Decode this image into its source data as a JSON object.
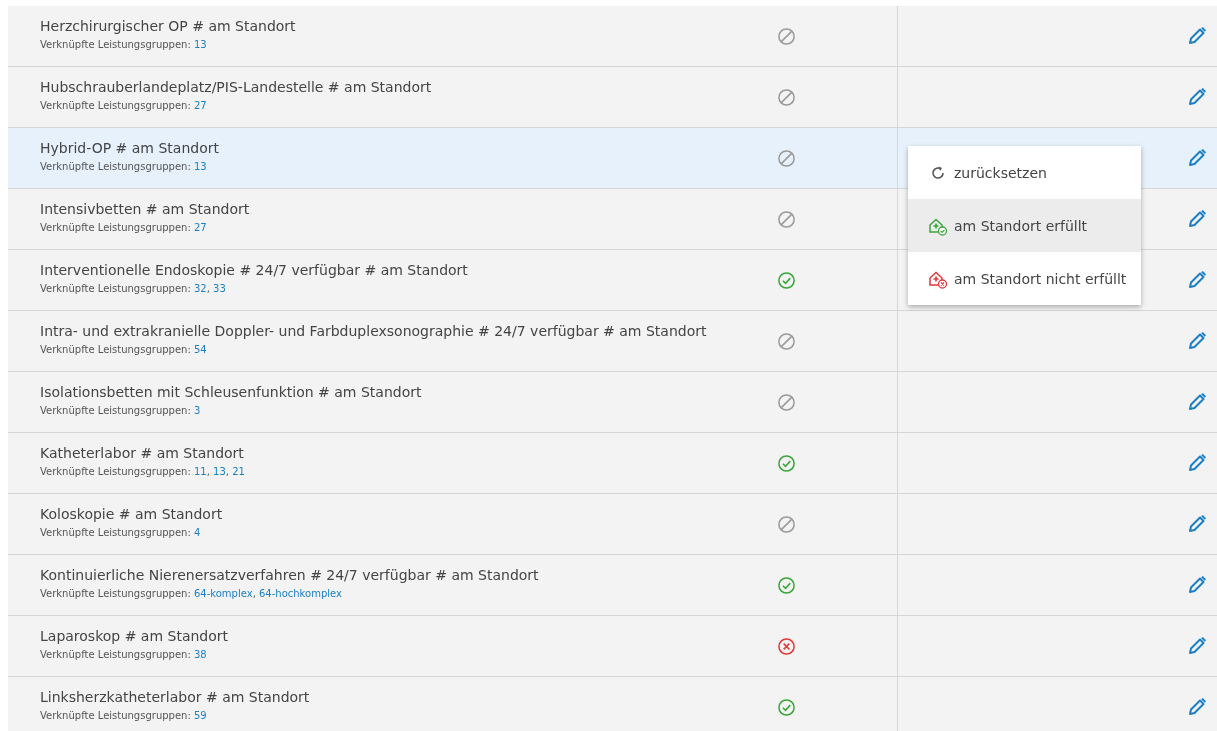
{
  "rows": [
    {
      "title": "Herzchirurgischer OP # am Standort",
      "groups_label": "Verknüpfte Leistungsgruppen:",
      "groups": [
        "13"
      ],
      "kind": "none",
      "selected": false
    },
    {
      "title": "Hubschrauberlandeplatz/PIS-Landestelle # am Standort",
      "groups_label": "Verknüpfte Leistungsgruppen:",
      "groups": [
        "27"
      ],
      "kind": "none",
      "selected": false
    },
    {
      "title": "Hybrid-OP # am Standort",
      "groups_label": "Verknüpfte Leistungsgruppen:",
      "groups": [
        "13"
      ],
      "kind": "none",
      "selected": true
    },
    {
      "title": "Intensivbetten # am Standort",
      "groups_label": "Verknüpfte Leistungsgruppen:",
      "groups": [
        "27"
      ],
      "kind": "none",
      "selected": false
    },
    {
      "title": "Interventionelle Endoskopie # 24/7 verfügbar # am Standort",
      "groups_label": "Verknüpfte Leistungsgruppen:",
      "groups": [
        "32",
        "33"
      ],
      "group_separator": ",",
      "kind": "fulfilled",
      "selected": false
    },
    {
      "title": "Intra- und extrakranielle Doppler- und Farbduplexsonographie # 24/7 verfügbar # am Standort",
      "groups_label": "Verknüpfte Leistungsgruppen:",
      "groups": [
        "54"
      ],
      "kind": "none",
      "selected": false
    },
    {
      "title": "Isolationsbetten mit Schleusenfunktion # am Standort",
      "groups_label": "Verknüpfte Leistungsgruppen:",
      "groups": [
        "3"
      ],
      "kind": "none",
      "selected": false
    },
    {
      "title": "Katheterlabor # am Standort",
      "groups_label": "Verknüpfte Leistungsgruppen:",
      "groups": [
        "11",
        "13",
        "21"
      ],
      "group_separator": ",",
      "kind": "fulfilled",
      "selected": false
    },
    {
      "title": "Koloskopie # am Standort",
      "groups_label": "Verknüpfte Leistungsgruppen:",
      "groups": [
        "4"
      ],
      "kind": "none",
      "selected": false
    },
    {
      "title": "Kontinuierliche Nierenersatzverfahren # 24/7 verfügbar # am Standort",
      "groups_label": "Verknüpfte Leistungsgruppen:",
      "groups": [
        "64-komplex",
        "64-hochkomplex"
      ],
      "group_separator": ",",
      "kind": "fulfilled",
      "selected": false
    },
    {
      "title": "Laparoskop # am Standort",
      "groups_label": "Verknüpfte Leistungsgruppen:",
      "groups": [
        "38"
      ],
      "kind": "not_fulfilled",
      "selected": false
    },
    {
      "title": "Linksherzkatheterlabor # am Standort",
      "groups_label": "Verknüpfte Leistungsgruppen:",
      "groups": [
        "59"
      ],
      "kind": "fulfilled",
      "selected": false
    }
  ],
  "menu": {
    "items": [
      {
        "kind": "reset",
        "label": "zurücksetzen",
        "selected": false
      },
      {
        "kind": "fulfilled",
        "label": "am Standort erfüllt",
        "selected": true
      },
      {
        "kind": "not_fulfilled",
        "label": "am Standort nicht erfüllt",
        "selected": false
      }
    ]
  }
}
